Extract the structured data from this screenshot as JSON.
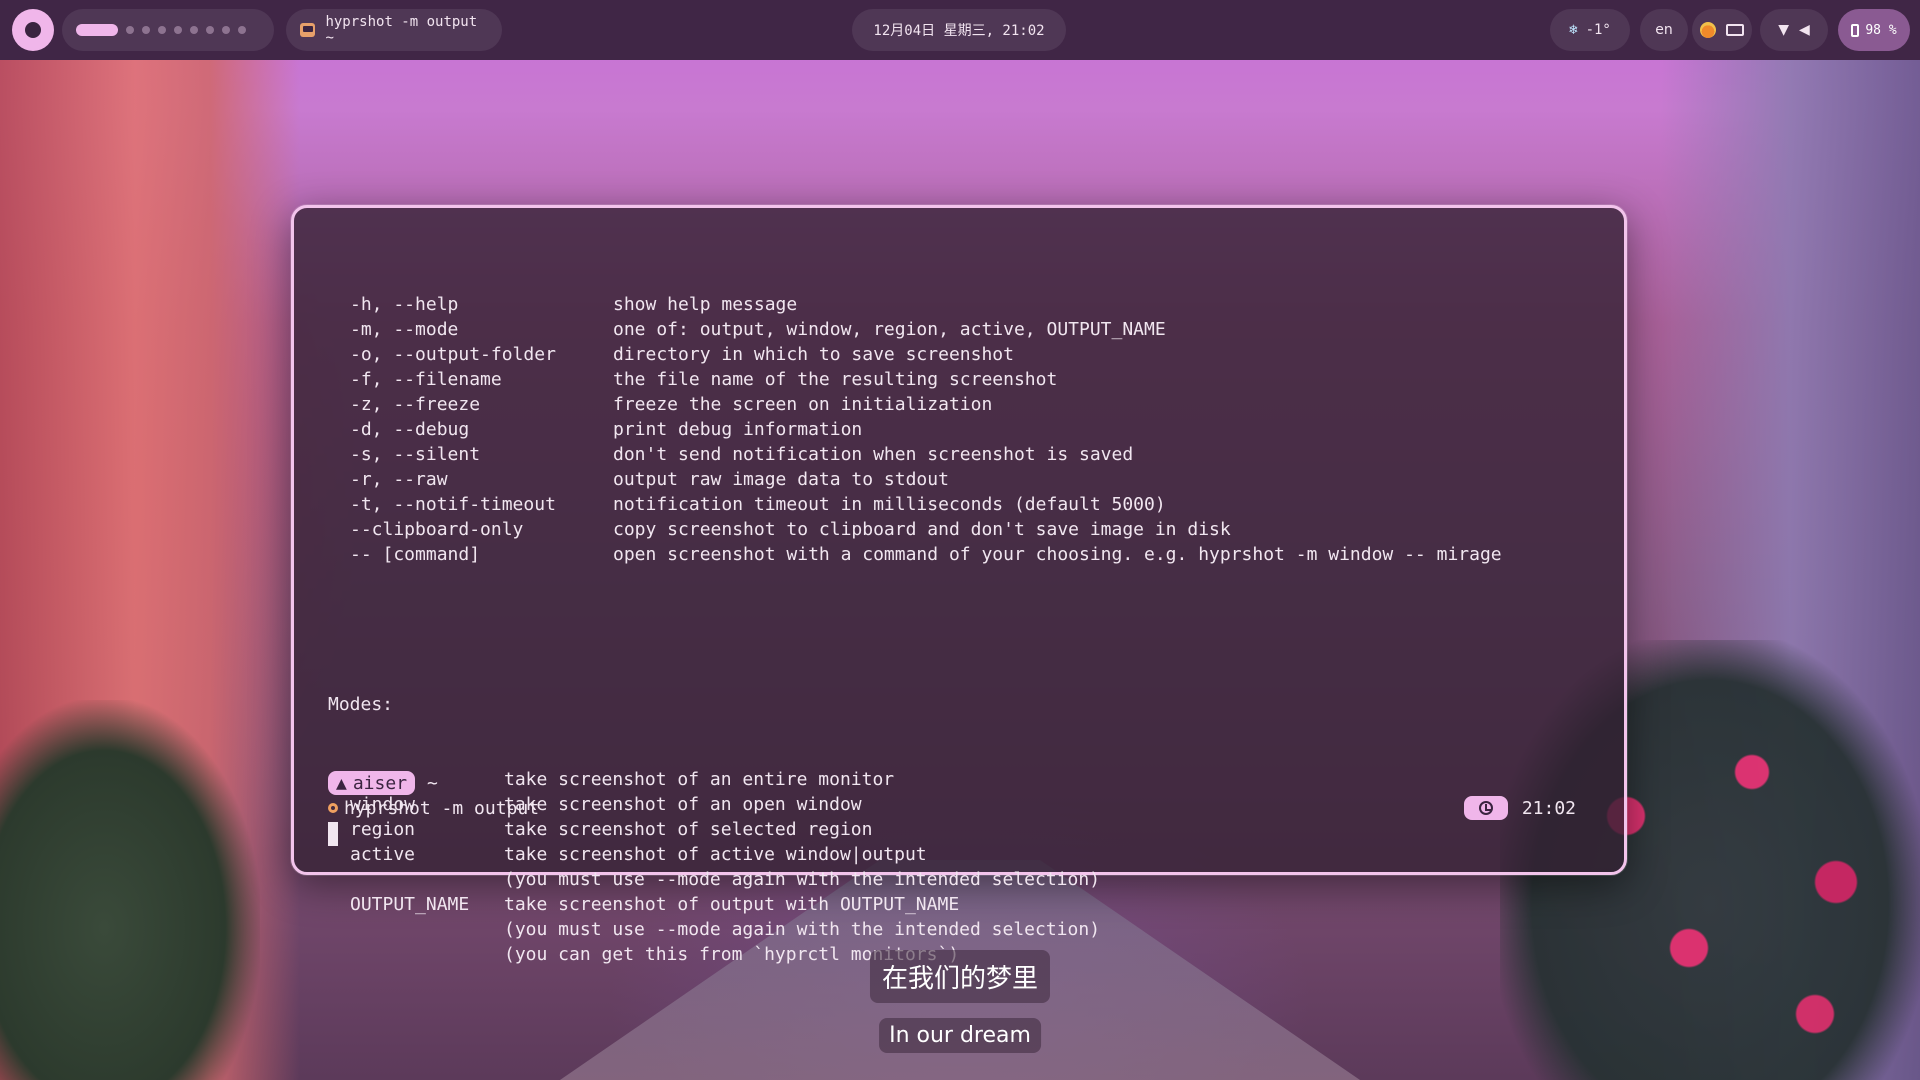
{
  "topbar": {
    "window_title": "hyprshot -m output ~",
    "clock": "12月04日 星期三, 21:02",
    "weather": "-1°",
    "weather_icon": "snowflake-icon",
    "language": "en",
    "battery": "98 %"
  },
  "terminal": {
    "options": [
      {
        "flag": "-h, --help",
        "desc": "show help message"
      },
      {
        "flag": "-m, --mode",
        "desc": "one of: output, window, region, active, OUTPUT_NAME"
      },
      {
        "flag": "-o, --output-folder",
        "desc": "directory in which to save screenshot"
      },
      {
        "flag": "-f, --filename",
        "desc": "the file name of the resulting screenshot"
      },
      {
        "flag": "-z, --freeze",
        "desc": "freeze the screen on initialization"
      },
      {
        "flag": "-d, --debug",
        "desc": "print debug information"
      },
      {
        "flag": "-s, --silent",
        "desc": "don't send notification when screenshot is saved"
      },
      {
        "flag": "-r, --raw",
        "desc": "output raw image data to stdout"
      },
      {
        "flag": "-t, --notif-timeout",
        "desc": "notification timeout in milliseconds (default 5000)"
      },
      {
        "flag": "--clipboard-only",
        "desc": "copy screenshot to clipboard and don't save image in disk"
      },
      {
        "flag": "-- [command]",
        "desc": "open screenshot with a command of your choosing. e.g. hyprshot -m window -- mirage"
      }
    ],
    "modes_heading": "Modes:",
    "modes": [
      {
        "name": "output",
        "desc": "take screenshot of an entire monitor"
      },
      {
        "name": "window",
        "desc": "take screenshot of an open window"
      },
      {
        "name": "region",
        "desc": "take screenshot of selected region"
      },
      {
        "name": "active",
        "desc": "take screenshot of active window|output"
      },
      {
        "name": "",
        "desc": "(you must use --mode again with the intended selection)"
      },
      {
        "name": "OUTPUT_NAME",
        "desc": "take screenshot of output with OUTPUT_NAME"
      },
      {
        "name": "",
        "desc": "(you must use --mode again with the intended selection)"
      },
      {
        "name": "",
        "desc": "(you can get this from `hyprctl monitors`)"
      }
    ],
    "prompt_user": "aiser",
    "prompt_dir": "~",
    "command": "hyprshot -m output",
    "time": "21:02"
  },
  "lyrics": {
    "chinese": "在我们的梦里",
    "english": "In our dream"
  }
}
